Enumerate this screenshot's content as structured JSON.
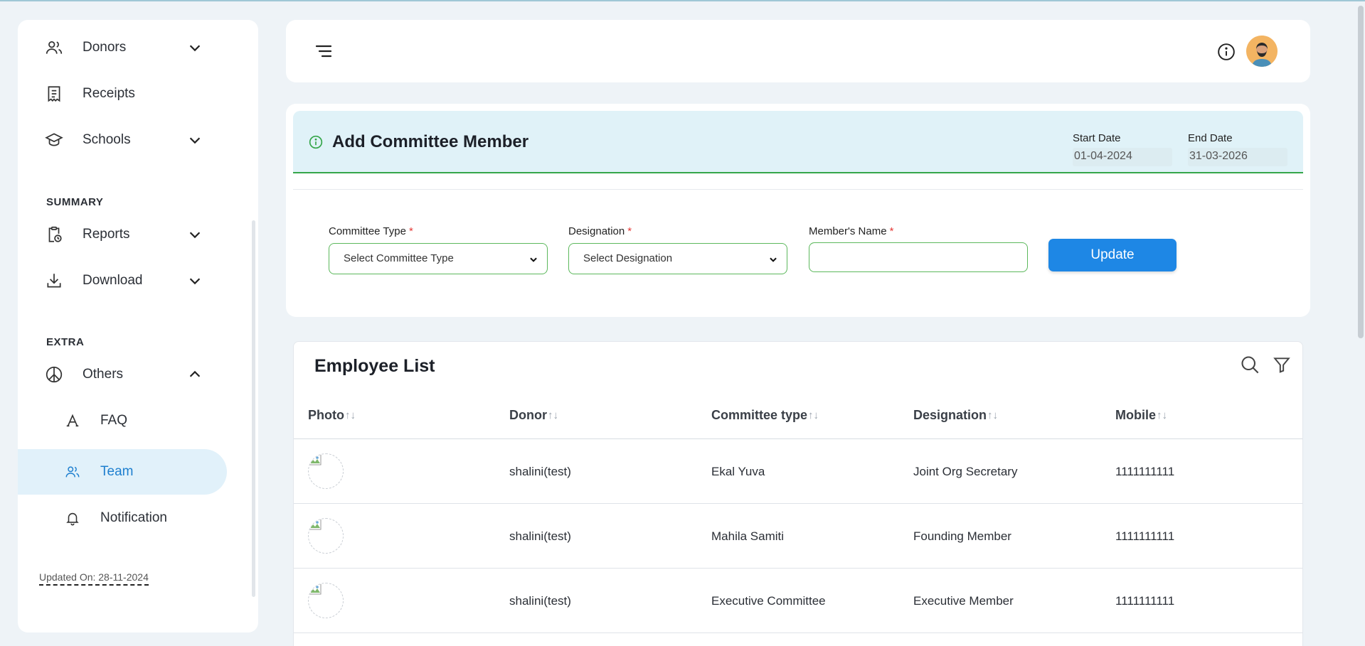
{
  "sidebar": {
    "items": [
      {
        "label": "Donors"
      },
      {
        "label": "Receipts"
      },
      {
        "label": "Schools"
      },
      {
        "label": "Reports"
      },
      {
        "label": "Download"
      },
      {
        "label": "Others"
      },
      {
        "label": "FAQ"
      },
      {
        "label": "Team"
      },
      {
        "label": "Notification"
      }
    ],
    "sections": {
      "summary": "SUMMARY",
      "extra": "EXTRA"
    },
    "updated": "Updated On: 28-11-2024",
    "active_color": "#1e7fcf"
  },
  "header": {
    "menu_icon": "hamburger-menu-icon",
    "info_icon": "info-icon",
    "avatar": "user-avatar"
  },
  "form": {
    "title": "Add Committee Member",
    "start_date_label": "Start Date",
    "start_date": "01-04-2024",
    "end_date_label": "End Date",
    "end_date": "31-03-2026",
    "committee_type_label": "Committee Type",
    "committee_type_value": "Select Committee Type",
    "designation_label": "Designation",
    "designation_value": "Select Designation",
    "member_name_label": "Member's Name",
    "member_name_value": "",
    "required_mark": "*",
    "update_label": "Update",
    "accent": "#1e87e5",
    "border_color": "#5cb85c"
  },
  "list": {
    "title": "Employee List",
    "columns": [
      "Photo",
      "Donor",
      "Committee type",
      "Designation",
      "Mobile"
    ],
    "sort_glyph": "↑↓",
    "rows": [
      {
        "donor": "shalini(test)",
        "committee_type": "Ekal Yuva",
        "designation": "Joint Org Secretary",
        "mobile": "1111111111"
      },
      {
        "donor": "shalini(test)",
        "committee_type": "Mahila Samiti",
        "designation": "Founding Member",
        "mobile": "1111111111"
      },
      {
        "donor": "shalini(test)",
        "committee_type": "Executive Committee",
        "designation": "Executive Member",
        "mobile": "1111111111"
      }
    ]
  }
}
